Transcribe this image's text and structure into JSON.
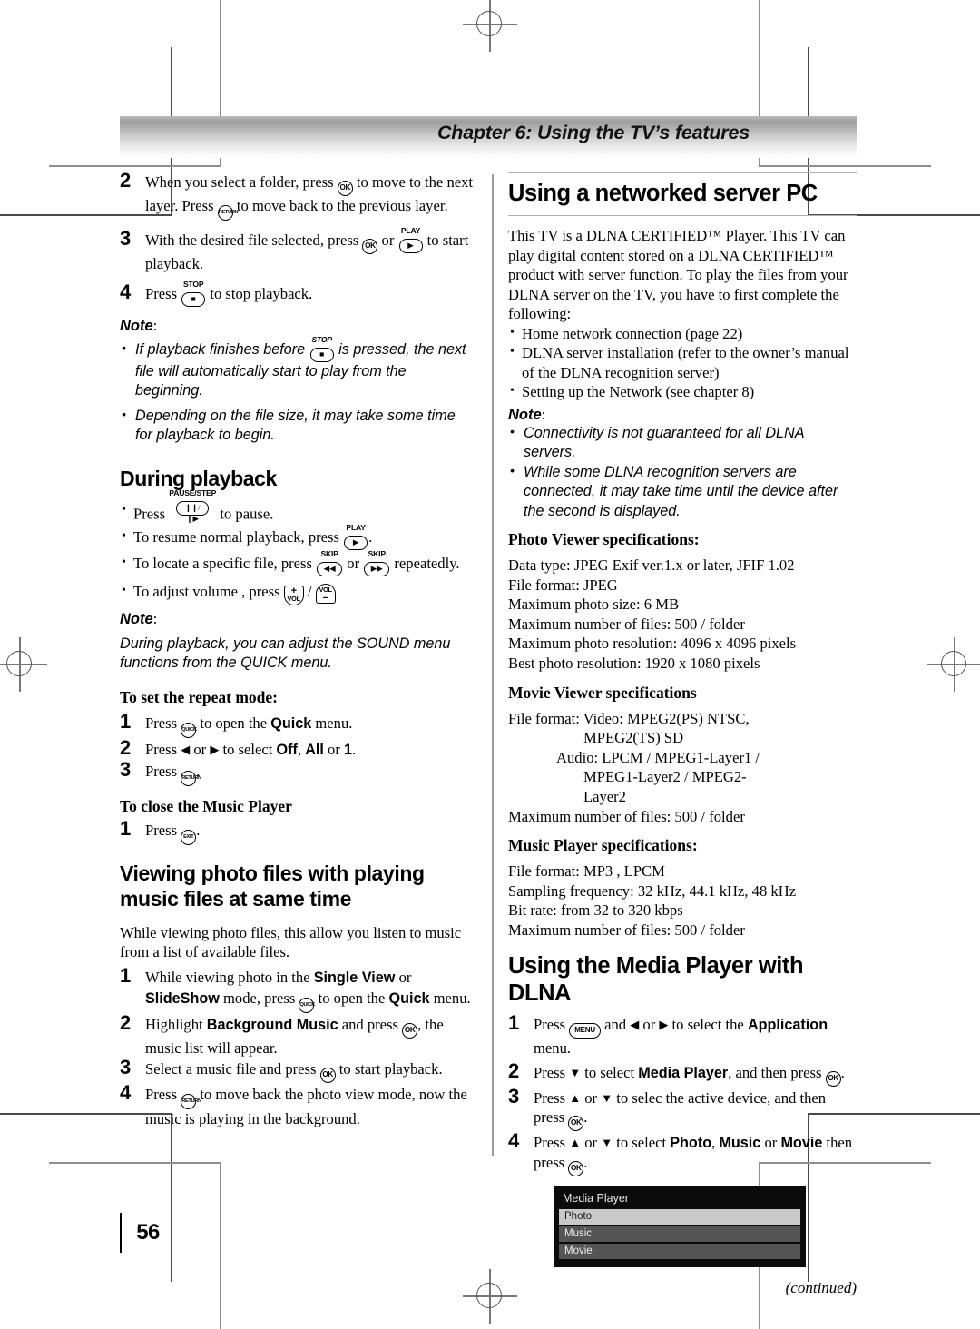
{
  "page": {
    "number": "56",
    "continued_label": "(continued)"
  },
  "header": {
    "chapter_title": "Chapter 6: Using the TV’s features"
  },
  "left_column": {
    "steps_top": [
      {
        "num": "2",
        "parts": [
          {
            "t": "text",
            "v": "When you select a folder, press "
          },
          {
            "t": "key",
            "v": "OK"
          },
          {
            "t": "text",
            "v": " to move to the next layer. Press "
          },
          {
            "t": "key",
            "v": "RETURN"
          },
          {
            "t": "text",
            "v": " to move back to the previous layer."
          }
        ]
      },
      {
        "num": "3",
        "parts": [
          {
            "t": "text",
            "v": "With the desired file selected, press "
          },
          {
            "t": "key",
            "v": "OK"
          },
          {
            "t": "text",
            "v": " or "
          },
          {
            "t": "key",
            "v": "PLAY"
          },
          {
            "t": "text",
            "v": " to start playback."
          }
        ]
      },
      {
        "num": "4",
        "parts": [
          {
            "t": "text",
            "v": "Press "
          },
          {
            "t": "key",
            "v": "STOP"
          },
          {
            "t": "text",
            "v": " to stop playback."
          }
        ]
      }
    ],
    "note_label": "Note",
    "note_bullets": [
      "If playback finishes before [STOP] is pressed, the next file will automatically start to play from the beginning.",
      "Depending on the file size, it may take some time for playback to begin."
    ],
    "note_bullet_1_a": "If playback finishes before",
    "note_bullet_1_b": "is pressed, the next file will automatically start to play from the beginning.",
    "note_bullet_2": "Depending on the file size, it may take some time for playback to begin.",
    "during_playback_heading": "During playback",
    "during_playback_bullets": {
      "b1_a": "Press",
      "b1_b": "to pause.",
      "b2_a": "To resume normal playback, press",
      "b2_b": ".",
      "b3_a": "To locate a specific file, press",
      "b3_b": "or",
      "b3_c": "repeatedly.",
      "b4_a": "To adjust volume , press",
      "b4_b": "/"
    },
    "note_label_2": "Note",
    "note_text_2": "During playback, you can adjust the SOUND menu functions from the QUICK menu.",
    "repeat_heading": "To set the repeat mode:",
    "repeat_steps": {
      "s1_a": "Press",
      "s1_b": "to open the",
      "s1_bold": "Quick",
      "s1_c": "menu.",
      "s2_a": "Press",
      "s2_arrow_l": "◀",
      "s2_b": "or",
      "s2_arrow_r": "▶",
      "s2_c": "to select",
      "s2_bold1": "Off",
      "s2_comma": ",",
      "s2_bold2": "All",
      "s2_d": "or",
      "s2_bold3": "1",
      "s2_e": ".",
      "s3_a": "Press",
      "s3_b": "."
    },
    "close_player_heading": "To close the Music Player",
    "close_player_step": {
      "num": "1",
      "a": "Press",
      "b": "."
    },
    "viewing_heading_line1": "Viewing photo files with playing",
    "viewing_heading_line2": "music files at same time",
    "viewing_intro": "While viewing photo files, this allow you listen to music from a list of available files.",
    "viewing_steps": {
      "s1_a": "While viewing photo in the",
      "s1_bold1": "Single View",
      "s1_b": "or",
      "s1_bold2": "SlideShow",
      "s1_c": "mode, press",
      "s1_d": "to open the",
      "s1_bold3": "Quick",
      "s1_e": "menu.",
      "s2_a": "Highlight",
      "s2_bold": "Background Music",
      "s2_b": "and press",
      "s2_c": ", the music list will appear.",
      "s3_a": "Select a music file and press",
      "s3_b": "to start playback.",
      "s4_a": "Press",
      "s4_b": "to move back the photo view mode, now the music is playing in the background."
    }
  },
  "right_column": {
    "networked_heading": "Using a networked server PC",
    "intro_paragraph": "This TV is a DLNA CERTIFIED™ Player. This TV can play digital content stored on a DLNA CERTIFIED™ product with server function. To play the files from your DLNA server on the TV, you have to first complete the following:",
    "intro_bullets": [
      "Home network connection (page 22)",
      "DLNA server installation (refer to the owner’s manual of the DLNA recognition server)",
      "Setting up the Network (see chapter 8)"
    ],
    "note_label": "Note",
    "note_bullets": [
      "Connectivity is not guaranteed for all DLNA servers.",
      "While some DLNA recognition servers are connected, it may take time until the device after the second is displayed."
    ],
    "photo_spec_heading": "Photo Viewer specifications:",
    "photo_specs": [
      "Data type: JPEG Exif ver.1.x or later, JFIF 1.02",
      "File format: JPEG",
      "Maximum photo size: 6 MB",
      "Maximum number of files: 500 / folder",
      "Maximum photo resolution: 4096 x 4096 pixels",
      "Best photo resolution: 1920 x 1080 pixels"
    ],
    "movie_spec_heading": "Movie Viewer specifications",
    "movie_specs": [
      "File format: Video: MPEG2(PS) NTSC,",
      "                    MPEG2(TS) SD",
      "             Audio: LPCM / MPEG1-Layer1 /",
      "                    MPEG1-Layer2 / MPEG2-",
      "                    Layer2",
      "Maximum number of files: 500 / folder"
    ],
    "music_spec_heading": "Music Player specifications:",
    "music_specs": [
      "File format: MP3 , LPCM",
      "Sampling frequency: 32 kHz, 44.1 kHz, 48 kHz",
      "Bit rate: from 32 to 320 kbps",
      "Maximum number of files: 500 / folder"
    ],
    "dlna_heading": "Using the Media Player with DLNA",
    "dlna_steps": {
      "s1_a": "Press",
      "s1_key": "MENU",
      "s1_b": "and",
      "s1_arrow_l": "◀",
      "s1_c": "or",
      "s1_arrow_r": "▶",
      "s1_d": "to select the",
      "s1_bold": "Application",
      "s1_e": "menu.",
      "s2_a": "Press",
      "s2_arrow_d": "▼",
      "s2_b": "to select",
      "s2_bold": "Media Player",
      "s2_c": ", and then press",
      "s2_d": ".",
      "s3_a": "Press",
      "s3_arrow_u": "▲",
      "s3_b": "or",
      "s3_arrow_d": "▼",
      "s3_c": "to selec the active device, and then press",
      "s3_d": ".",
      "s4_a": "Press",
      "s4_arrow_u": "▲",
      "s4_b": "or",
      "s4_arrow_d": "▼",
      "s4_c": "to select",
      "s4_bold1": "Photo",
      "s4_comma": ",",
      "s4_bold2": "Music",
      "s4_d": "or",
      "s4_bold3": "Movie",
      "s4_e": "then press",
      "s4_f": "."
    },
    "media_player_screenshot": {
      "title": "Media Player",
      "rows": [
        {
          "label": "Photo",
          "selected": true
        },
        {
          "label": "Music",
          "selected": false
        },
        {
          "label": "Movie",
          "selected": false
        }
      ]
    }
  },
  "keys": {
    "ok": "OK",
    "return": "RETURN",
    "quick": "QUICK",
    "exit": "EXIT",
    "menu": "MENU",
    "play_caption": "PLAY",
    "stop_caption": "STOP",
    "pause_caption": "PAUSE/STEP",
    "skip_caption": "SKIP",
    "vol_label": "VOL",
    "vol_plus": "+",
    "vol_minus": "−"
  }
}
